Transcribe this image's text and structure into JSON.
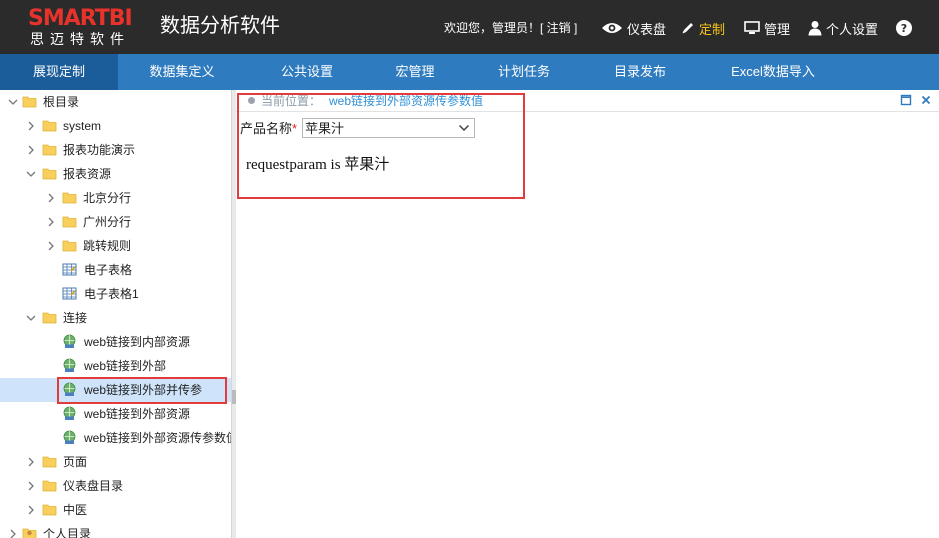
{
  "header": {
    "logo_main": "SMARTBI",
    "logo_sub": "思迈特软件",
    "app_title": "数据分析软件",
    "welcome": "欢迎您，管理员！[ 注销 ]",
    "nav": [
      {
        "label": "仪表盘",
        "icon": "eye-icon"
      },
      {
        "label": "定制",
        "icon": "pencil-icon",
        "active": true
      },
      {
        "label": "管理",
        "icon": "monitor-icon"
      },
      {
        "label": "个人设置",
        "icon": "user-icon"
      },
      {
        "label": "?",
        "icon": "help-icon"
      }
    ],
    "accent_color": "#f5c518"
  },
  "menu": [
    {
      "label": "展现定制",
      "active": true
    },
    {
      "label": "数据集定义"
    },
    {
      "label": "公共设置"
    },
    {
      "label": "宏管理"
    },
    {
      "label": "计划任务"
    },
    {
      "label": "目录发布"
    },
    {
      "label": "Excel数据导入"
    }
  ],
  "tree": [
    {
      "label": "根目录",
      "type": "folder",
      "expanded": true
    },
    {
      "label": "system",
      "type": "folder"
    },
    {
      "label": "报表功能演示",
      "type": "folder"
    },
    {
      "label": "报表资源",
      "type": "folder",
      "expanded": true
    },
    {
      "label": "北京分行",
      "type": "folder"
    },
    {
      "label": "广州分行",
      "type": "folder"
    },
    {
      "label": "跳转规则",
      "type": "folder"
    },
    {
      "label": "电子表格",
      "type": "spreadsheet"
    },
    {
      "label": "电子表格1",
      "type": "spreadsheet"
    },
    {
      "label": "连接",
      "type": "folder",
      "expanded": true
    },
    {
      "label": "web链接到内部资源",
      "type": "weblink"
    },
    {
      "label": "web链接到外部",
      "type": "weblink"
    },
    {
      "label": "web链接到外部并传参",
      "type": "weblink",
      "selected": true
    },
    {
      "label": "web链接到外部资源",
      "type": "weblink"
    },
    {
      "label": "web链接到外部资源传参数值",
      "type": "weblink"
    },
    {
      "label": "页面",
      "type": "folder"
    },
    {
      "label": "仪表盘目录",
      "type": "folder"
    },
    {
      "label": "中医",
      "type": "folder"
    },
    {
      "label": "个人目录",
      "type": "user-folder"
    }
  ],
  "content": {
    "breadcrumb_label": "当前位置：",
    "breadcrumb_value": "web链接到外部资源传参数值",
    "param_label": "产品名称",
    "required_mark": "*",
    "param_value": "苹果汁",
    "result_text": "requestparam is 苹果汁"
  }
}
